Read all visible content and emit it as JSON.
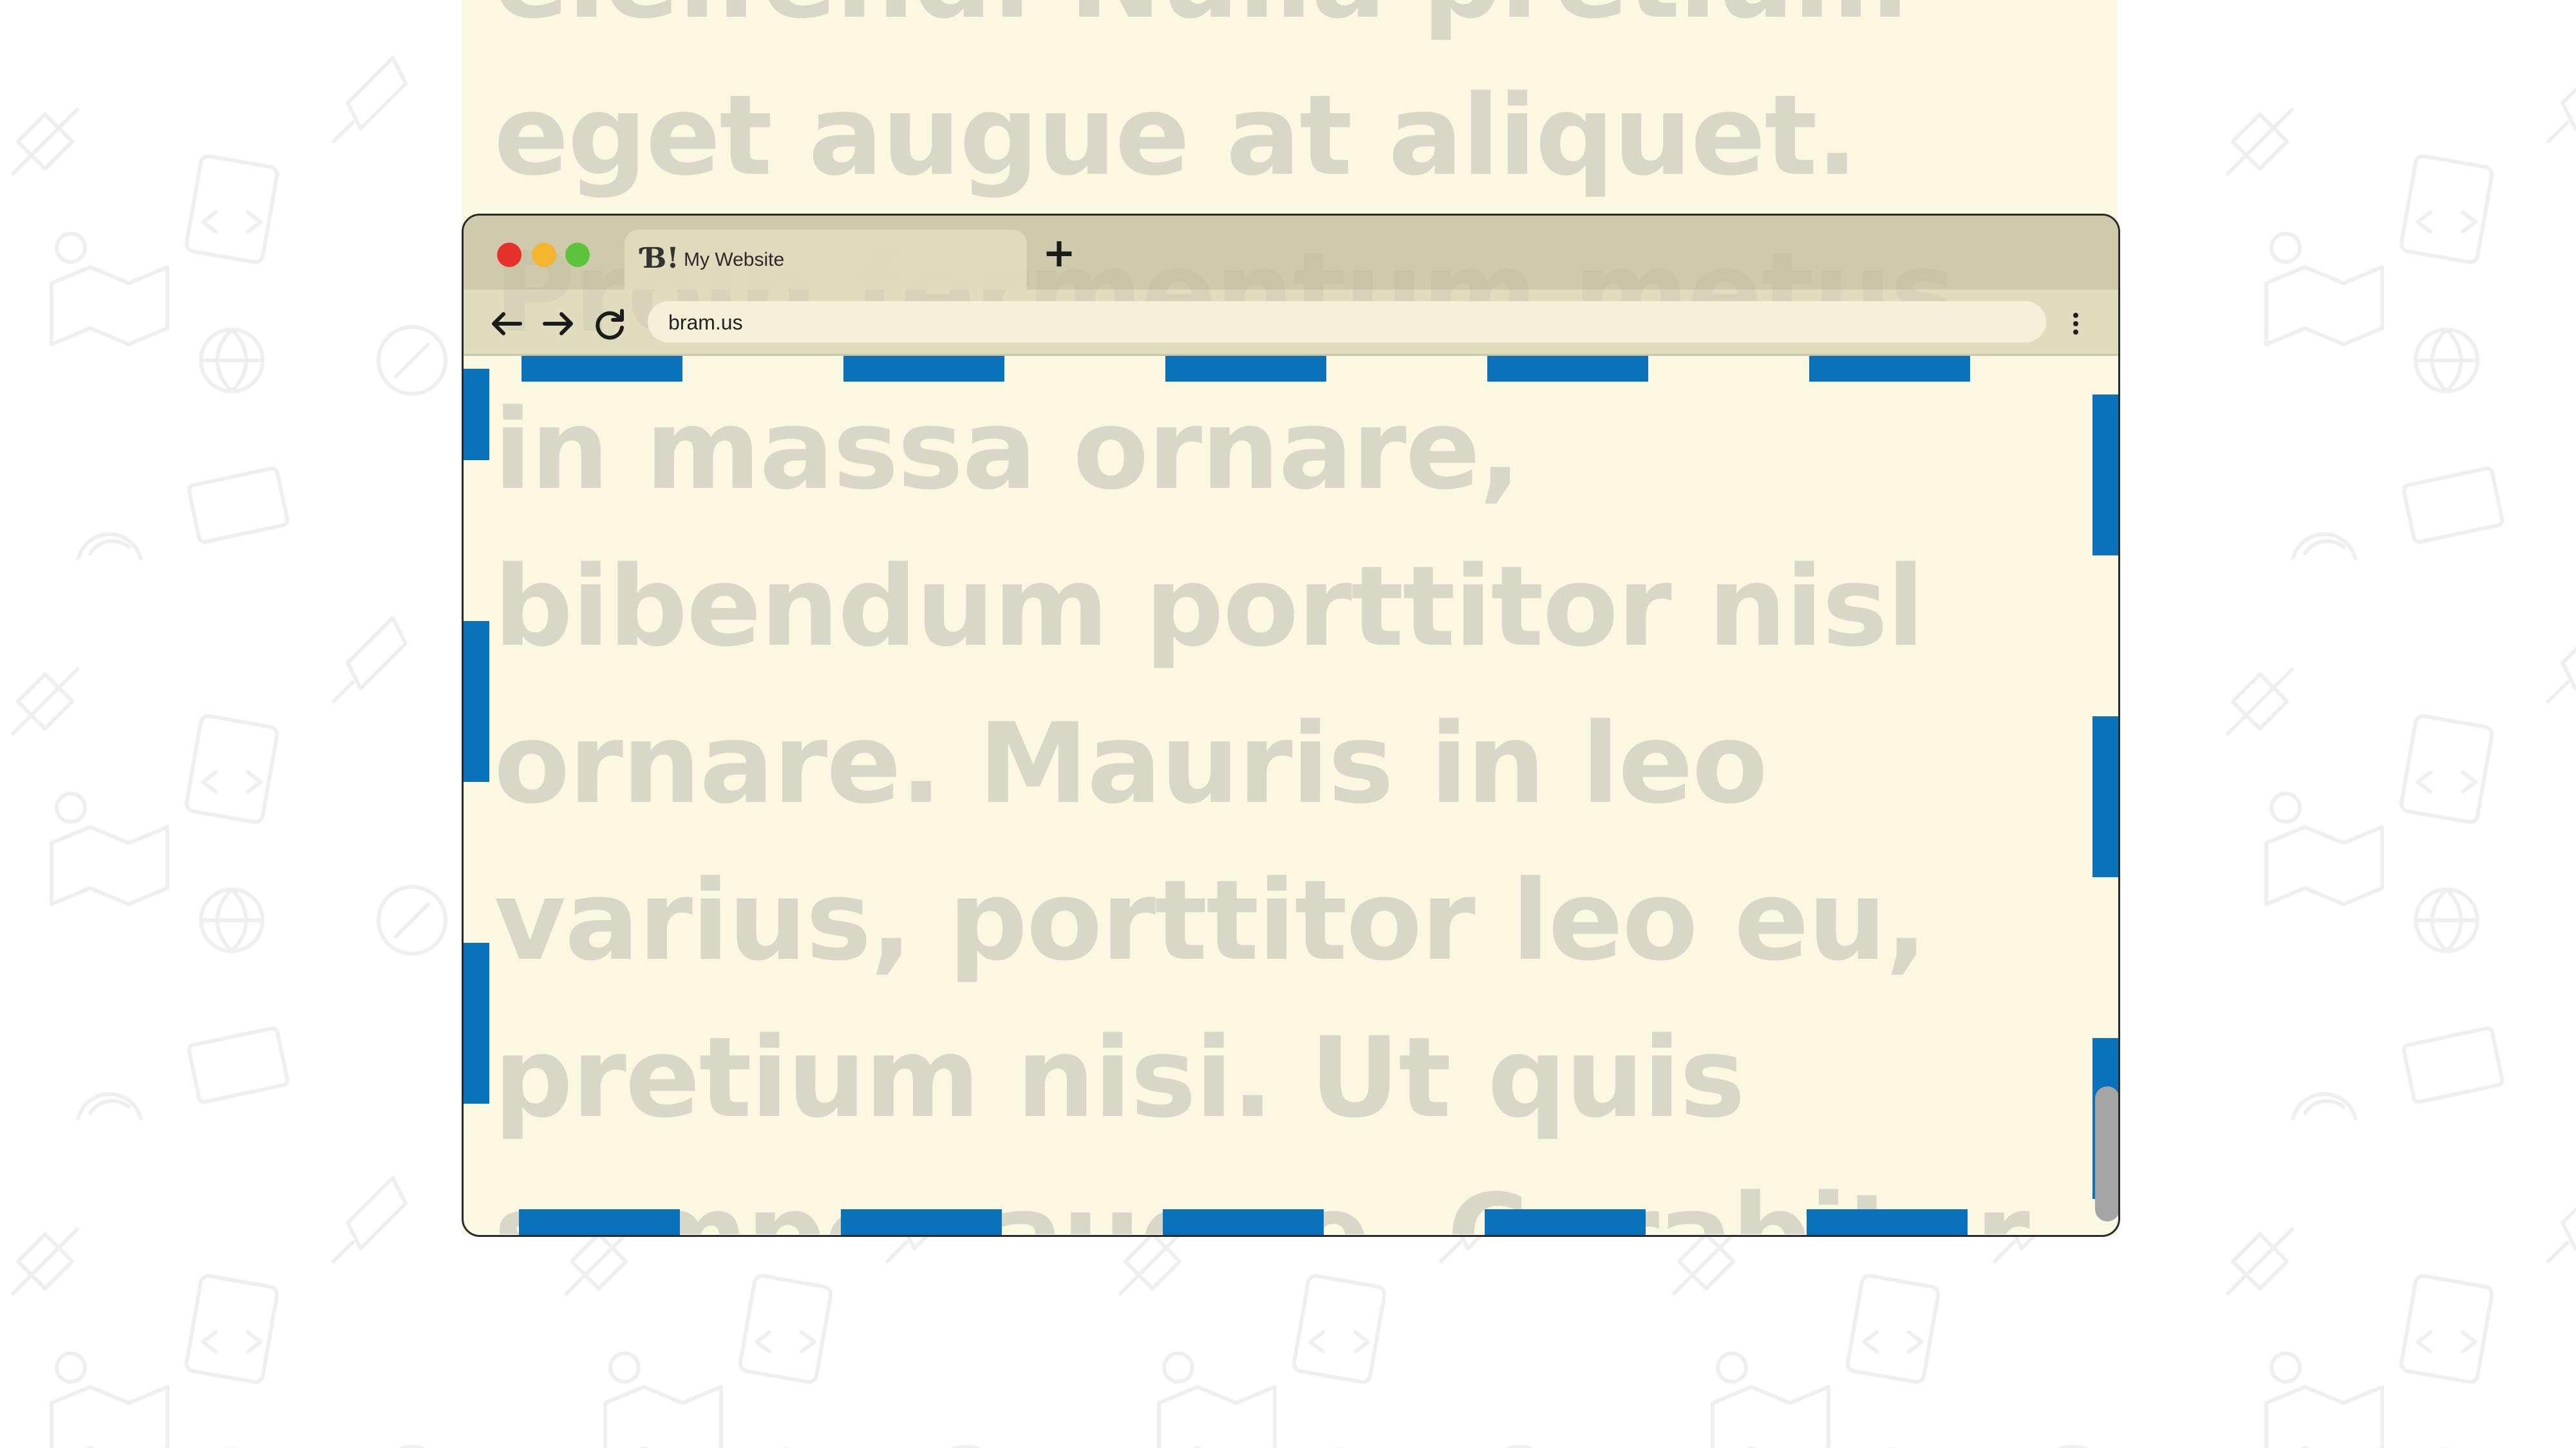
{
  "page": {
    "text": "eleifend. Nulla pretium eget augue at aliquet. Proin fermentum metus in massa ornare, bibendum porttitor nisl ornare. Mauris in leo varius, porttitor leo eu, pretium nisi. Ut quis semper augue. Curabitur ultricies"
  },
  "browser": {
    "tab": {
      "favicon": "Ɓ!",
      "title": "My Website"
    },
    "new_tab": "+",
    "address": "bram.us",
    "icons": {
      "back": "arrow-left-icon",
      "forward": "arrow-right-icon",
      "reload": "reload-icon",
      "menu": "vertical-dots-icon"
    }
  },
  "colors": {
    "close": "#e6312a",
    "minimize": "#f5b52f",
    "maximize": "#5bc43c",
    "viewport_outline": "#0a72bb",
    "content_background": "#fbf8e1"
  }
}
